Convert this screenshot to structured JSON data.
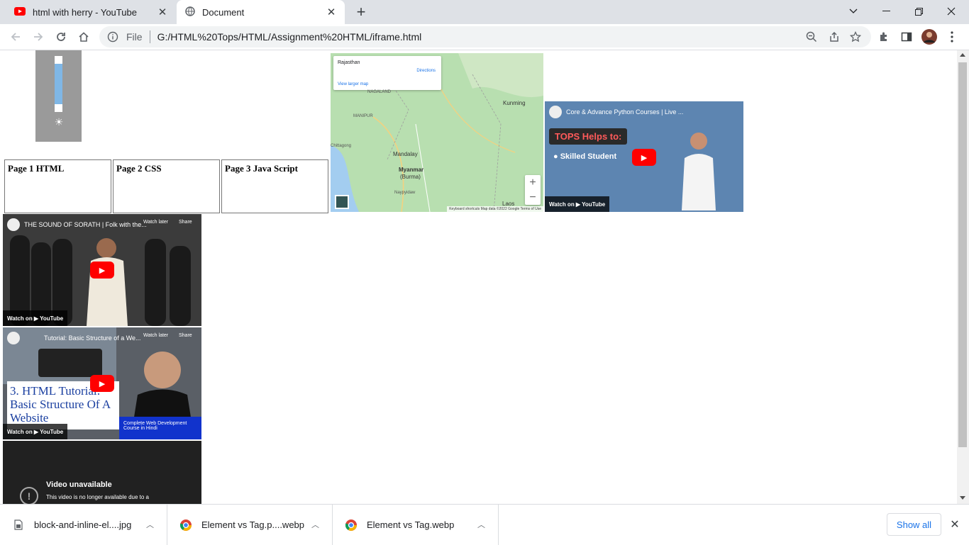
{
  "browser": {
    "tabs": [
      {
        "title": "html with herry - YouTube",
        "icon": "youtube-icon"
      },
      {
        "title": "Document",
        "icon": "globe-icon"
      }
    ],
    "address": {
      "scheme_label": "File",
      "url": "G:/HTML%20Tops/HTML/Assignment%20HTML/iframe.html"
    }
  },
  "page": {
    "table": [
      "Page 1 HTML",
      "Page 2 CSS",
      "Page 3 Java Script"
    ],
    "map": {
      "place": "Rajasthan",
      "directions": "Directions",
      "view_larger": "View larger map",
      "labels": [
        "NAGALAND",
        "MANIPUR",
        "Mandalay",
        "Myanmar",
        "(Burma)",
        "Kunming",
        "Laos",
        "Naypyidaw",
        "Chittagong"
      ],
      "zoom_in": "+",
      "zoom_out": "−",
      "attribution": "Keyboard shortcuts  Map data ©2022 Google  Terms of Use"
    },
    "videos": [
      {
        "title": "Core & Advance Python Courses | Live ...",
        "banner": "TOPS Helps to:",
        "subline": "● Skilled Student",
        "watch": "Watch on ▶ YouTube"
      },
      {
        "title": "THE SOUND OF SORATH | Folk with the...",
        "watch_later": "Watch later",
        "share": "Share",
        "watch": "Watch on ▶ YouTube"
      },
      {
        "title": "Tutorial: Basic Structure of a We...",
        "watch_later": "Watch later",
        "share": "Share",
        "overlay": "3. HTML Tutorial: Basic Structure Of A Website",
        "strip": "Complete Web Development Course in Hindi",
        "watch": "Watch on ▶ YouTube"
      },
      {
        "unavailable_title": "Video unavailable",
        "unavailable_msg": "This video is no longer available due to a"
      }
    ]
  },
  "downloads": {
    "items": [
      "block-and-inline-el....jpg",
      "Element vs Tag.p....webp",
      "Element vs Tag.webp"
    ],
    "show_all": "Show all"
  }
}
